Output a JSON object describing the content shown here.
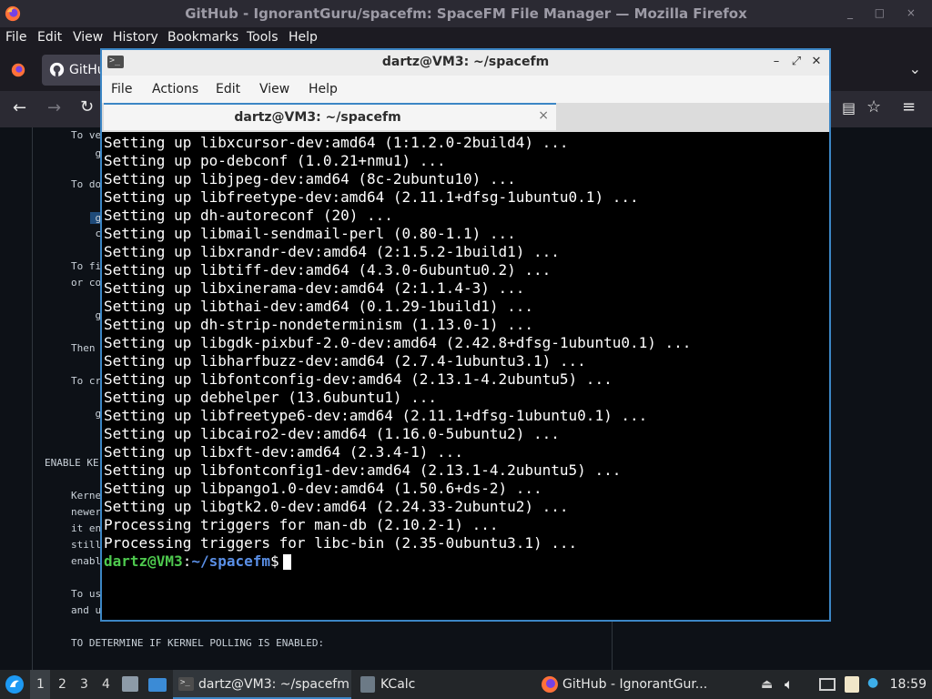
{
  "firefox": {
    "title": "GitHub - IgnorantGuru/spacefm: SpaceFM File Manager — Mozilla Firefox",
    "window_buttons": "_ □ ×",
    "menus": [
      "File",
      "Edit",
      "View",
      "History",
      "Bookmarks",
      "Tools",
      "Help"
    ],
    "tab_label": "GitHu",
    "doc_lines": [
      {
        "text": "To ve"
      },
      {
        "text": "    g"
      },
      {
        "text": "To do"
      },
      {
        "text": "    g"
      },
      {
        "text": "    c"
      },
      {
        "text": "To fi"
      },
      {
        "text": "or co"
      },
      {
        "text": "    g"
      },
      {
        "text": "Then"
      },
      {
        "text": "To cr"
      },
      {
        "text": "    g"
      },
      {
        "text": "ENABLE KE"
      },
      {
        "text": "Kerne"
      },
      {
        "text": "newer"
      },
      {
        "text": "it en"
      },
      {
        "text": "still"
      },
      {
        "text": "enabl"
      },
      {
        "text": "To us"
      },
      {
        "text": "and u"
      },
      {
        "text": "TO DETERMINE IF KERNEL POLLING IS ENABLED:"
      }
    ]
  },
  "terminal": {
    "title": "dartz@VM3: ~/spacefm",
    "window_buttons": [
      "–",
      "⤢",
      "✕"
    ],
    "menus": [
      "File",
      "Actions",
      "Edit",
      "View",
      "Help"
    ],
    "tab_label": "dartz@VM3: ~/spacefm",
    "tab_close": "×",
    "lines": [
      "Setting up libxcursor-dev:amd64 (1:1.2.0-2build4) ...",
      "Setting up po-debconf (1.0.21+nmu1) ...",
      "Setting up libjpeg-dev:amd64 (8c-2ubuntu10) ...",
      "Setting up libfreetype-dev:amd64 (2.11.1+dfsg-1ubuntu0.1) ...",
      "Setting up dh-autoreconf (20) ...",
      "Setting up libmail-sendmail-perl (0.80-1.1) ...",
      "Setting up libxrandr-dev:amd64 (2:1.5.2-1build1) ...",
      "Setting up libtiff-dev:amd64 (4.3.0-6ubuntu0.2) ...",
      "Setting up libxinerama-dev:amd64 (2:1.1.4-3) ...",
      "Setting up libthai-dev:amd64 (0.1.29-1build1) ...",
      "Setting up dh-strip-nondeterminism (1.13.0-1) ...",
      "Setting up libgdk-pixbuf-2.0-dev:amd64 (2.42.8+dfsg-1ubuntu0.1) ...",
      "Setting up libharfbuzz-dev:amd64 (2.7.4-1ubuntu3.1) ...",
      "Setting up libfontconfig-dev:amd64 (2.13.1-4.2ubuntu5) ...",
      "Setting up debhelper (13.6ubuntu1) ...",
      "Setting up libfreetype6-dev:amd64 (2.11.1+dfsg-1ubuntu0.1) ...",
      "Setting up libcairo2-dev:amd64 (1.16.0-5ubuntu2) ...",
      "Setting up libxft-dev:amd64 (2.3.4-1) ...",
      "Setting up libfontconfig1-dev:amd64 (2.13.1-4.2ubuntu5) ...",
      "Setting up libpango1.0-dev:amd64 (1.50.6+ds-2) ...",
      "Setting up libgtk2.0-dev:amd64 (2.24.33-2ubuntu2) ...",
      "Processing triggers for man-db (2.10.2-1) ...",
      "Processing triggers for libc-bin (2.35-0ubuntu3.1) ..."
    ],
    "prompt_user": "dartz@VM3",
    "prompt_sep": ":",
    "prompt_path": "~/spacefm",
    "prompt_symbol": "$"
  },
  "taskbar": {
    "workspaces": [
      "1",
      "2",
      "3",
      "4"
    ],
    "tasks": [
      {
        "label": "dartz@VM3: ~/spacefm"
      },
      {
        "label": "KCalc"
      },
      {
        "label": "GitHub - IgnorantGur..."
      }
    ],
    "clock": "18:59"
  },
  "colors": {
    "accent": "#3c86c5",
    "prompt_user": "#4ec94e",
    "prompt_path": "#5a8fe6",
    "firefox_orange": "#ff7139"
  }
}
